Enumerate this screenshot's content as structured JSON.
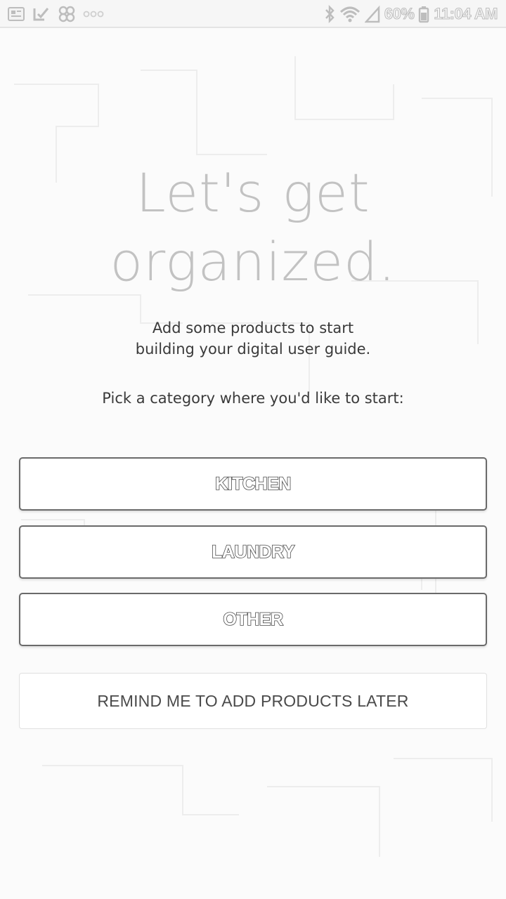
{
  "status_bar": {
    "battery_percent": "60%",
    "time": "11:04 AM",
    "icons": [
      "gallery-icon",
      "checklist-icon",
      "pinwheel-icon",
      "more-dots-icon",
      "bluetooth-icon",
      "wifi-icon",
      "signal-icon",
      "battery-icon"
    ]
  },
  "onboarding": {
    "headline_line1": "Let's get",
    "headline_line2": "organized.",
    "subtext_line1": "Add some products to start",
    "subtext_line2": "building your digital user guide.",
    "prompt": "Pick a category where you'd like to start:"
  },
  "categories": [
    {
      "label": "KITCHEN"
    },
    {
      "label": "LAUNDRY"
    },
    {
      "label": "OTHER"
    }
  ],
  "remind_label": "REMIND ME TO ADD PRODUCTS LATER",
  "colors": {
    "background": "#fbfbfb",
    "headline": "#c2c2c2",
    "body_text": "#3a3a3a",
    "button_border": "#6a6a6a"
  }
}
